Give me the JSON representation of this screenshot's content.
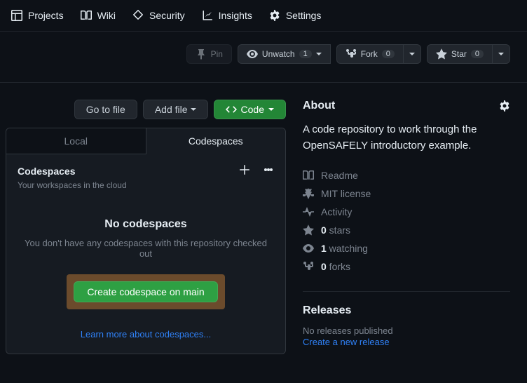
{
  "nav": {
    "projects": "Projects",
    "wiki": "Wiki",
    "security": "Security",
    "insights": "Insights",
    "settings": "Settings"
  },
  "actions": {
    "pin": "Pin",
    "unwatch": "Unwatch",
    "unwatch_count": "1",
    "fork": "Fork",
    "fork_count": "0",
    "star": "Star",
    "star_count": "0"
  },
  "repo_buttons": {
    "go_to_file": "Go to file",
    "add_file": "Add file",
    "code": "Code"
  },
  "code_popover": {
    "tab_local": "Local",
    "tab_codespaces": "Codespaces",
    "title": "Codespaces",
    "subtitle": "Your workspaces in the cloud",
    "empty_title": "No codespaces",
    "empty_desc": "You don't have any codespaces with this repository checked out",
    "create_btn": "Create codespace on main",
    "learn_more": "Learn more about codespaces..."
  },
  "about": {
    "heading": "About",
    "description": "A code repository to work through the OpenSAFELY introductory example.",
    "readme": "Readme",
    "license": "MIT license",
    "activity": "Activity",
    "stars_count": "0",
    "stars_label": " stars",
    "watching_count": "1",
    "watching_label": " watching",
    "forks_count": "0",
    "forks_label": " forks"
  },
  "releases": {
    "heading": "Releases",
    "none": "No releases published",
    "create": "Create a new release"
  }
}
